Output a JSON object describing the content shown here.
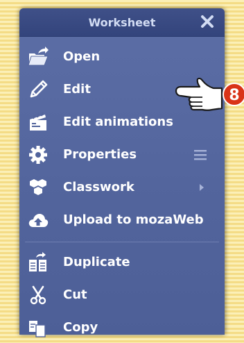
{
  "menu": {
    "title": "Worksheet",
    "items": [
      {
        "label": "Open",
        "icon": "folder-open-icon"
      },
      {
        "label": "Edit",
        "icon": "pencil-icon"
      },
      {
        "label": "Edit animations",
        "icon": "clapperboard-icon"
      },
      {
        "label": "Properties",
        "icon": "gear-icon",
        "extra": "hamburger-icon"
      },
      {
        "label": "Classwork",
        "icon": "group-icon",
        "extra": "submenu-arrow-icon"
      },
      {
        "label": "Upload to mozaWeb",
        "icon": "cloud-upload-icon"
      },
      {
        "label": "Duplicate",
        "icon": "duplicate-icon"
      },
      {
        "label": "Cut",
        "icon": "scissors-icon"
      },
      {
        "label": "Copy",
        "icon": "copy-icon"
      }
    ]
  },
  "callout": {
    "number": "8",
    "color": "#d93318"
  },
  "colors": {
    "panel": "#52649c",
    "header": "#3a4b83",
    "icon": "#ffffff"
  }
}
